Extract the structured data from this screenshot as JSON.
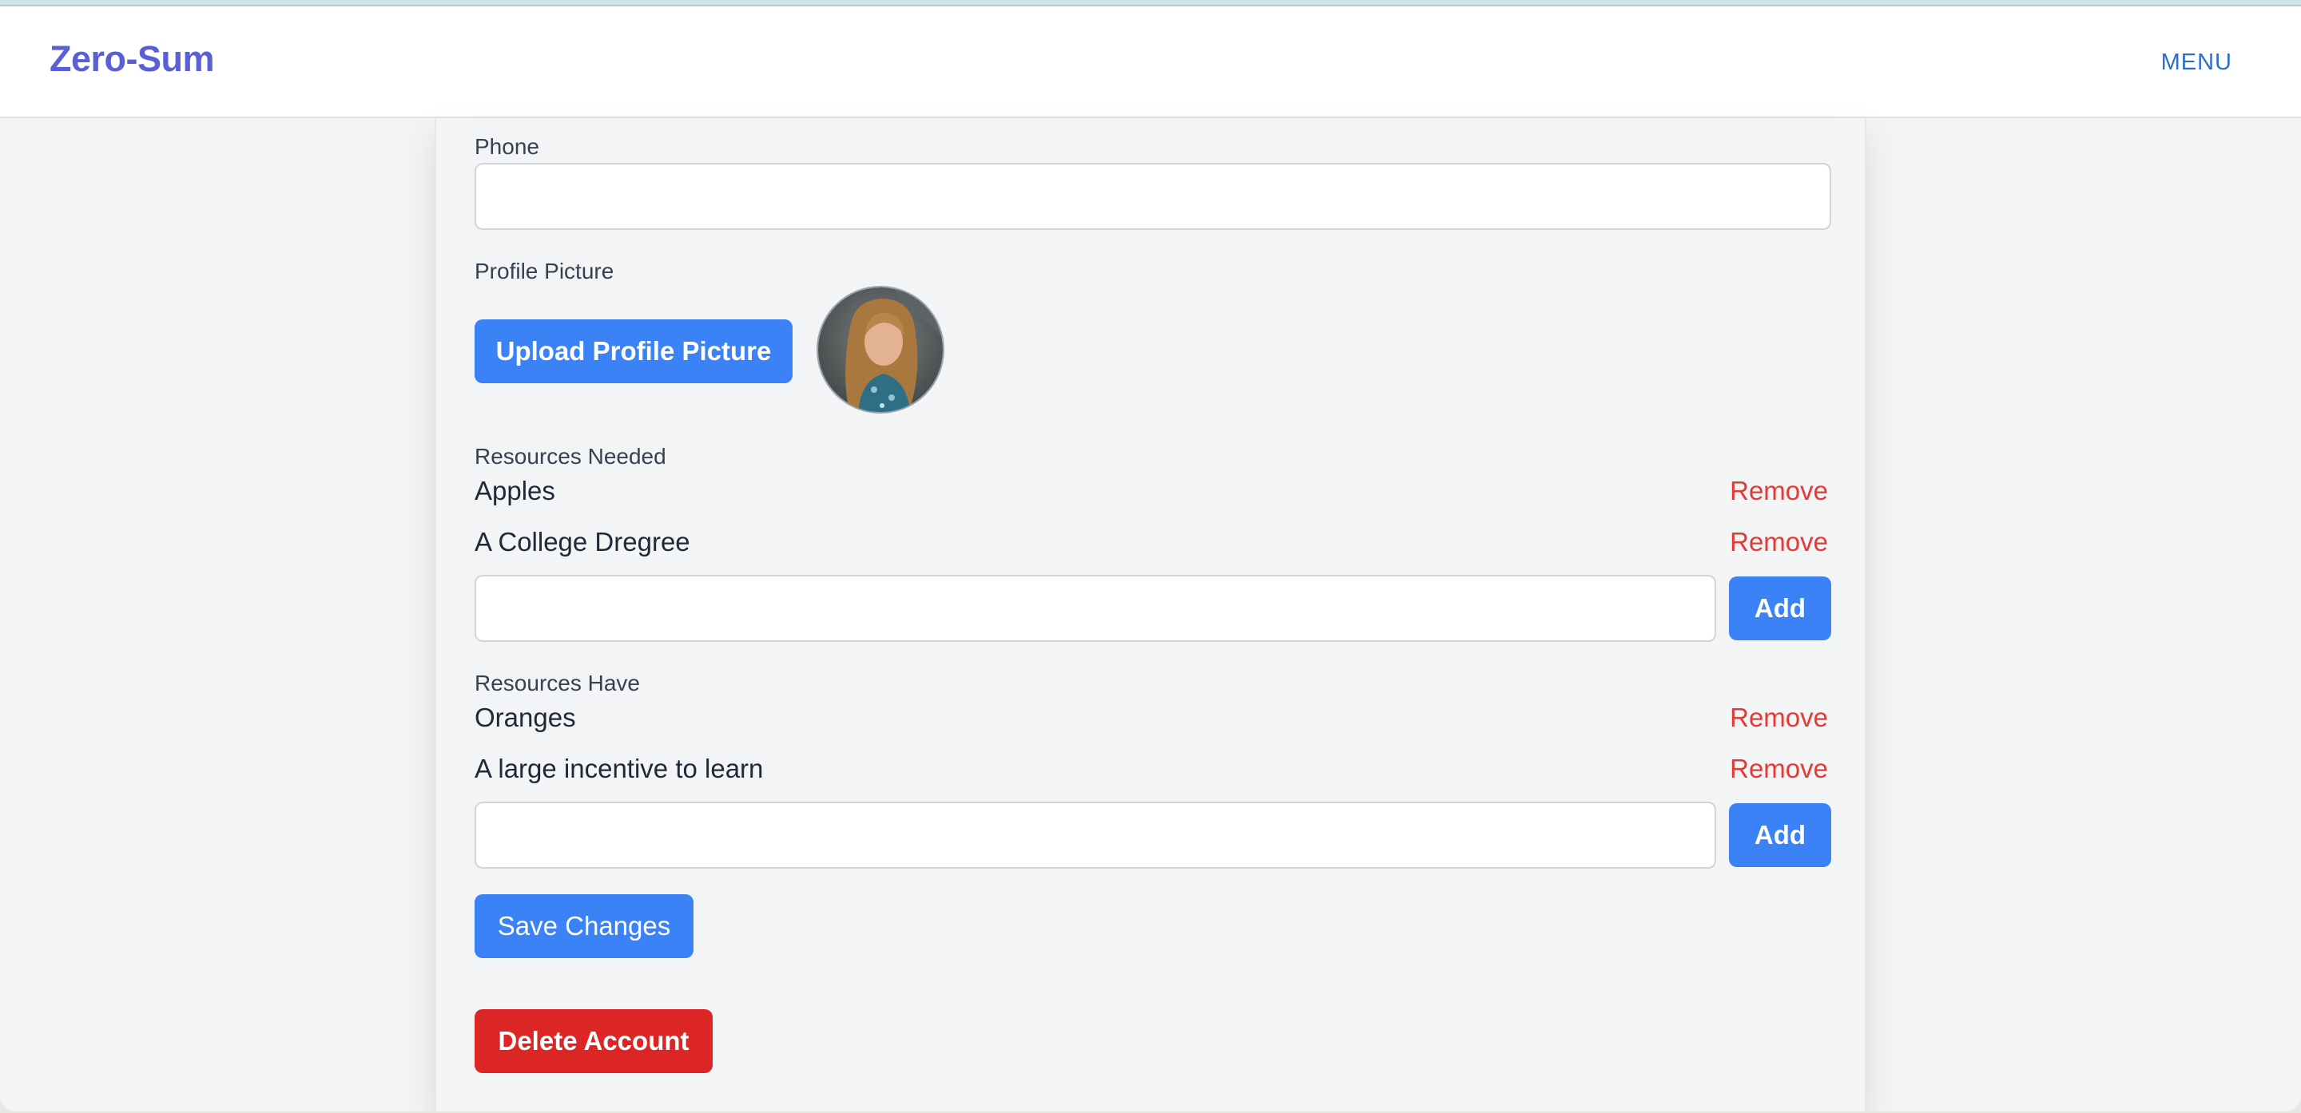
{
  "header": {
    "logo": "Zero-Sum",
    "menu_label": "MENU"
  },
  "form": {
    "phone": {
      "label": "Phone",
      "value": "",
      "placeholder": ""
    },
    "profile_picture": {
      "label": "Profile Picture",
      "upload_label": "Upload Profile Picture",
      "avatar_icon": "profile-photo"
    },
    "resources_needed": {
      "label": "Resources Needed",
      "items": [
        {
          "text": "Apples",
          "remove_label": "Remove"
        },
        {
          "text": "A College Dregree",
          "remove_label": "Remove"
        }
      ],
      "input_value": "",
      "add_label": "Add"
    },
    "resources_have": {
      "label": "Resources Have",
      "items": [
        {
          "text": "Oranges",
          "remove_label": "Remove"
        },
        {
          "text": "A large incentive to learn",
          "remove_label": "Remove"
        }
      ],
      "input_value": "",
      "add_label": "Add"
    },
    "save_label": "Save Changes",
    "delete_label": "Delete Account"
  },
  "colors": {
    "brand": "#5b5fd6",
    "primary": "#3b82f6",
    "danger": "#dc2626",
    "remove_text": "#e53935",
    "menu": "#2d6ec8"
  }
}
